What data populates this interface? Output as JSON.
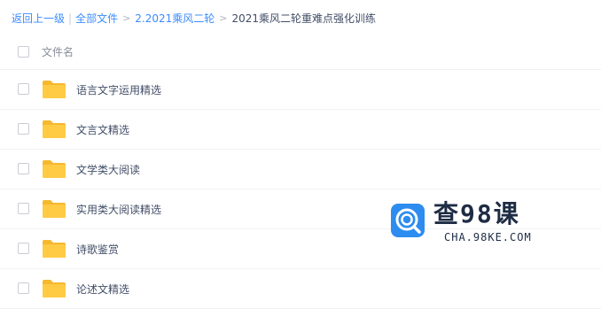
{
  "breadcrumb": {
    "back": "返回上一级",
    "separator_pipe": "|",
    "all_files": "全部文件",
    "separator": ">",
    "parent": "2.2021乘风二轮",
    "current": "2021乘风二轮重难点强化训练"
  },
  "list": {
    "header": "文件名",
    "items": [
      {
        "name": "语言文字运用精选",
        "icon": "folder-icon"
      },
      {
        "name": "文言文精选",
        "icon": "folder-icon"
      },
      {
        "name": "文学类大阅读",
        "icon": "folder-icon"
      },
      {
        "name": "实用类大阅读精选",
        "icon": "folder-icon"
      },
      {
        "name": "诗歌鉴赏",
        "icon": "folder-icon"
      },
      {
        "name": "论述文精选",
        "icon": "folder-icon"
      }
    ]
  },
  "watermark": {
    "title": "查98课",
    "url": "CHA.98KE.COM"
  },
  "colors": {
    "link": "#3b8cff",
    "folder": "#ffcb45",
    "folder_tab": "#f5b82e",
    "watermark_logo": "#2d8cf0",
    "watermark_text": "#1e2c44"
  }
}
